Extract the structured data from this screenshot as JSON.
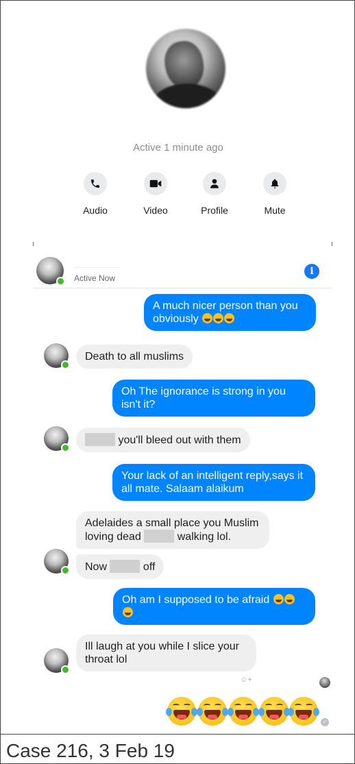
{
  "profile": {
    "active_status": "Active 1 minute ago",
    "actions": [
      {
        "label": "Audio",
        "icon": "phone-icon"
      },
      {
        "label": "Video",
        "icon": "video-camera-icon"
      },
      {
        "label": "Profile",
        "icon": "person-icon"
      },
      {
        "label": "Mute",
        "icon": "bell-icon"
      }
    ]
  },
  "chat": {
    "status": "Active Now",
    "info_icon": "i",
    "messages": [
      {
        "type": "sent",
        "text": "A much nicer person than you obviously"
      },
      {
        "type": "received",
        "text": "Death to all muslims"
      },
      {
        "type": "sent",
        "text": "Oh The ignorance is strong in you isn't it?"
      },
      {
        "type": "received",
        "text": "you'll bleed out with them"
      },
      {
        "type": "sent",
        "text": "Your lack of an intelligent reply,says it all mate. Salaam alaikum"
      },
      {
        "type": "received",
        "text_a": "Adelaides a small place you Muslim loving dead",
        "text_b": "walking lol."
      },
      {
        "type": "received",
        "text_a": "Now",
        "text_b": "off"
      },
      {
        "type": "sent",
        "text": "Oh am I supposed to be afraid"
      },
      {
        "type": "received",
        "text": "Ill laugh at you while I slice your throat lol"
      }
    ],
    "reaction_hint": "☺+",
    "final_emojis": "😂😂😂😂😂",
    "sent_check": "✓"
  },
  "caption": "Case 216, 3 Feb 19",
  "colors": {
    "sent_bubble": "#0084ff",
    "received_bubble": "#efefef",
    "online_dot": "#42b72a",
    "info_blue": "#1877f2"
  }
}
